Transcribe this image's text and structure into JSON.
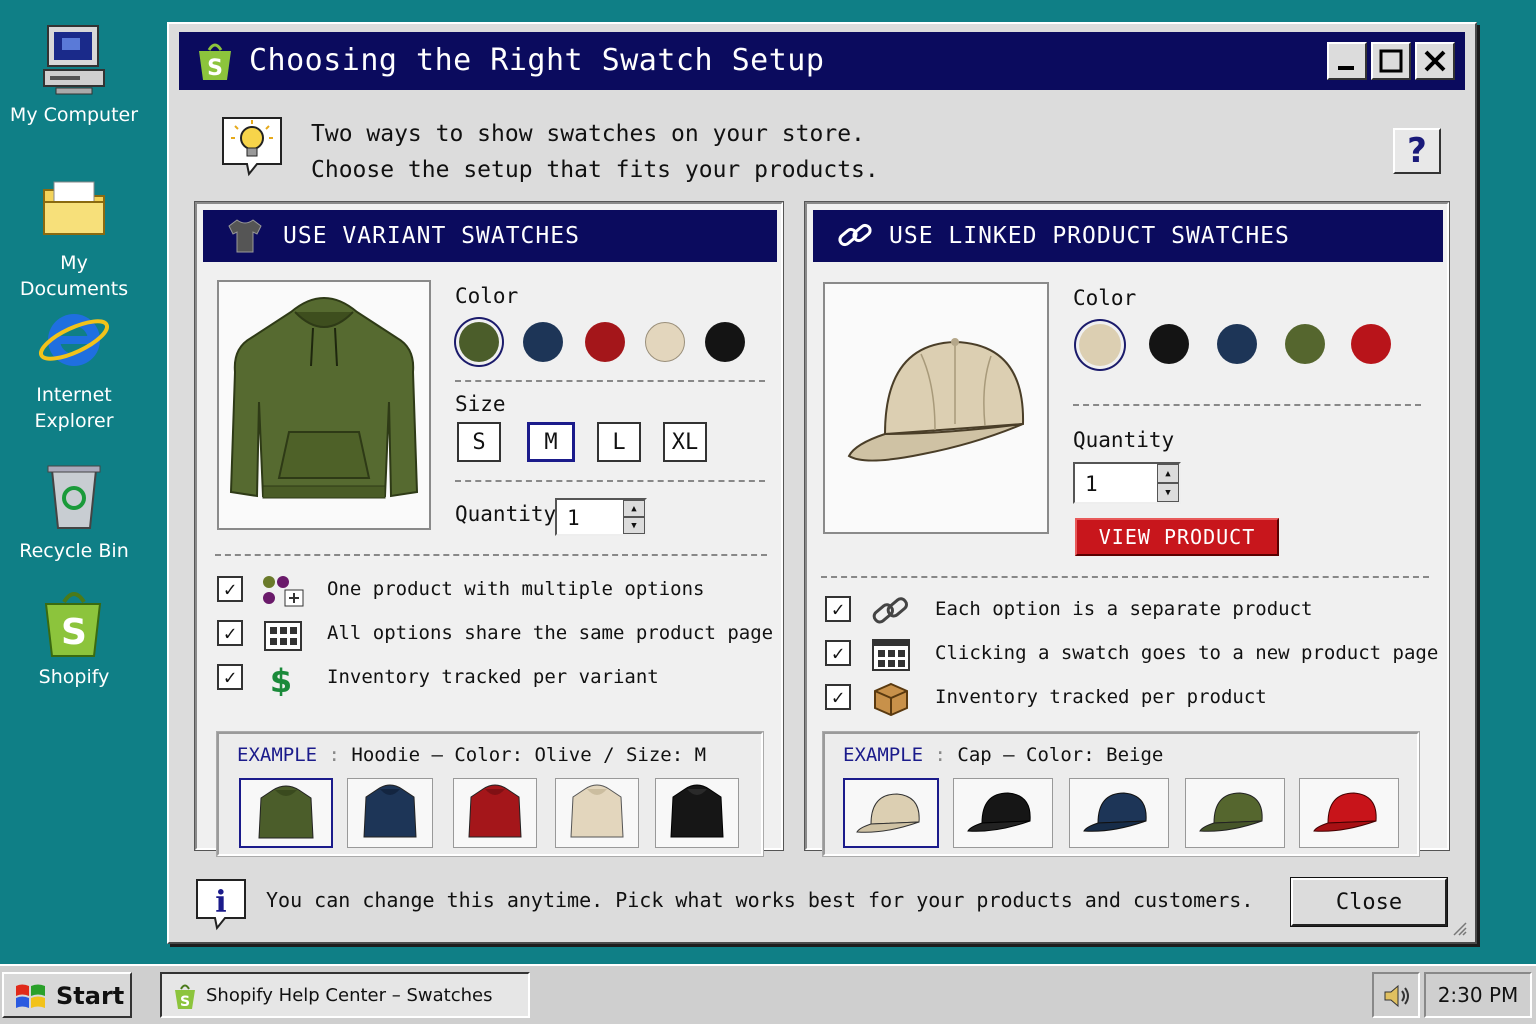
{
  "desktop": {
    "icons": [
      {
        "label": "My Computer"
      },
      {
        "label": "My Documents"
      },
      {
        "label": "Internet Explorer"
      },
      {
        "label": "Recycle Bin"
      },
      {
        "label": "Shopify"
      }
    ]
  },
  "window": {
    "title": "Choosing the Right Swatch Setup",
    "intro_line1": "Two ways to show swatches on your store.",
    "intro_line2": "Choose the setup that fits your products.",
    "help_label": "?",
    "footer_text": "You can change this anytime. Pick what works best for your products and customers.",
    "close_label": "Close"
  },
  "variant_panel": {
    "heading": "USE VARIANT SWATCHES",
    "color_label": "Color",
    "colors": [
      "#4b5d2a",
      "#1d3557",
      "#a4161a",
      "#e3d6bd",
      "#141414"
    ],
    "size_label": "Size",
    "sizes": [
      "S",
      "M",
      "L",
      "XL"
    ],
    "selected_size": "M",
    "quantity_label": "Quantity",
    "quantity_value": "1",
    "features": [
      "One product with multiple options",
      "All options share the same product page",
      "Inventory tracked per variant"
    ],
    "example_tag": "EXAMPLE",
    "example_text": "Hoodie – Color: Olive / Size: M"
  },
  "linked_panel": {
    "heading": "USE LINKED PRODUCT SWATCHES",
    "color_label": "Color",
    "colors": [
      "#dccfb2",
      "#141414",
      "#1d3557",
      "#55662e",
      "#b8141a"
    ],
    "quantity_label": "Quantity",
    "quantity_value": "1",
    "view_button": "VIEW PRODUCT",
    "features": [
      "Each option is a separate product",
      "Clicking a swatch goes to a new product page",
      "Inventory tracked per product"
    ],
    "example_tag": "EXAMPLE",
    "example_text": "Cap – Color: Beige"
  },
  "taskbar": {
    "start_label": "Start",
    "task_label": "Shopify Help Center – Swatches",
    "clock": "2:30 PM"
  }
}
